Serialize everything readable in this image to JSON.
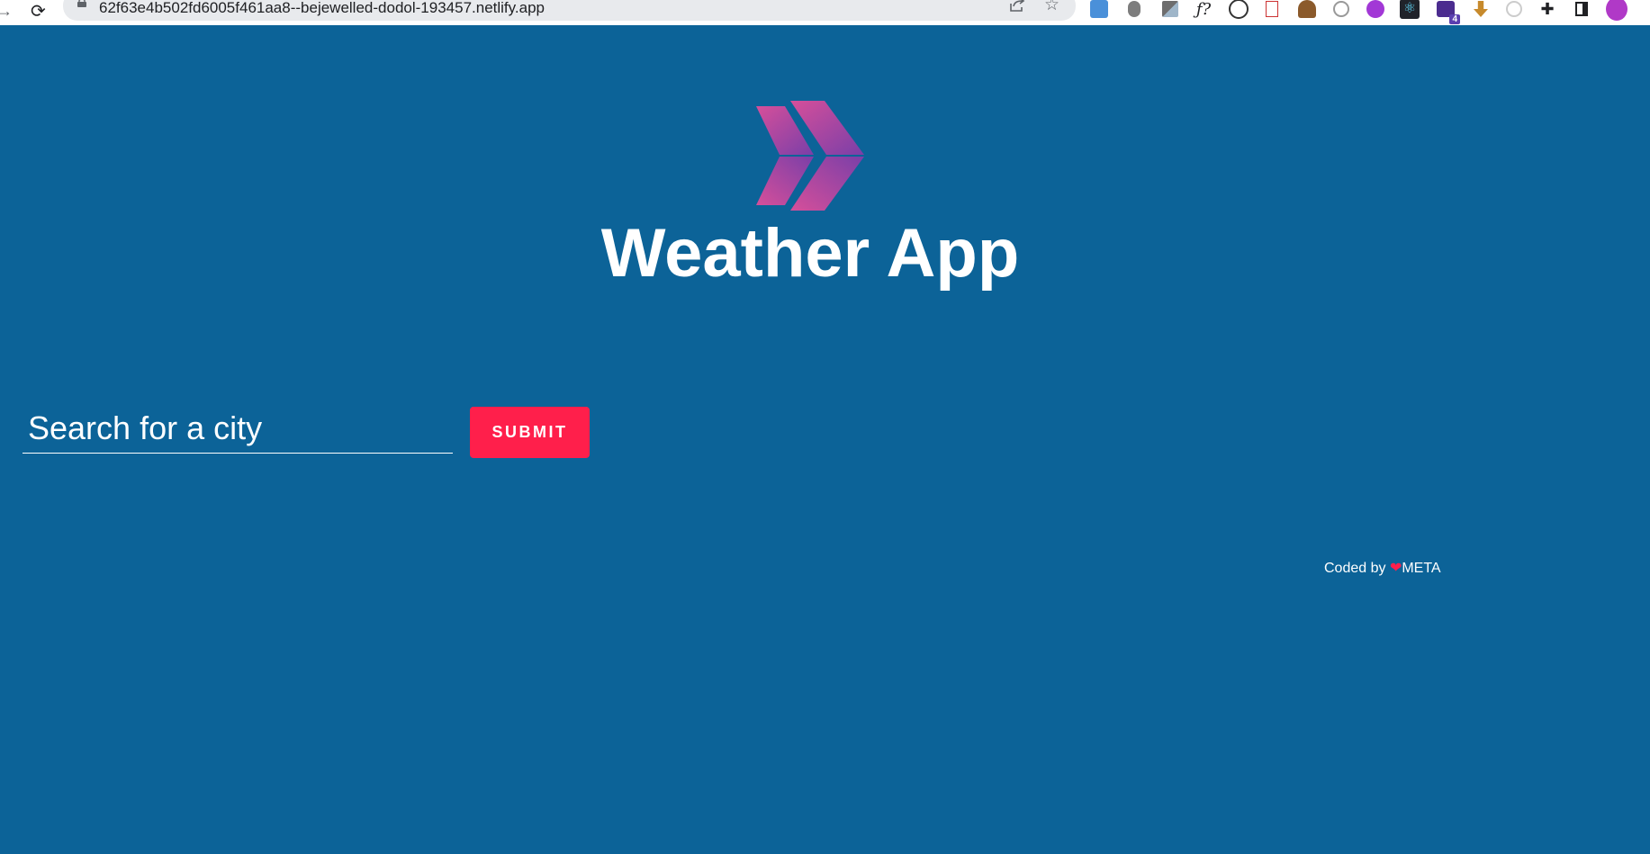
{
  "browser": {
    "url": "62f63e4b502fd6005f461aa8--bejewelled-dodol-193457.netlify.app",
    "extensions_badge": "4"
  },
  "header": {
    "logo_icon": "double-chevron-logo",
    "title": "Weather App"
  },
  "search": {
    "placeholder": "Search for a city",
    "value": "",
    "submit_label": "SUBMIT"
  },
  "footer": {
    "prefix": "Coded by ",
    "heart": "❤",
    "author": "META"
  },
  "colors": {
    "background": "#0c6398",
    "accent": "#ff1f4b",
    "text": "#ffffff"
  }
}
